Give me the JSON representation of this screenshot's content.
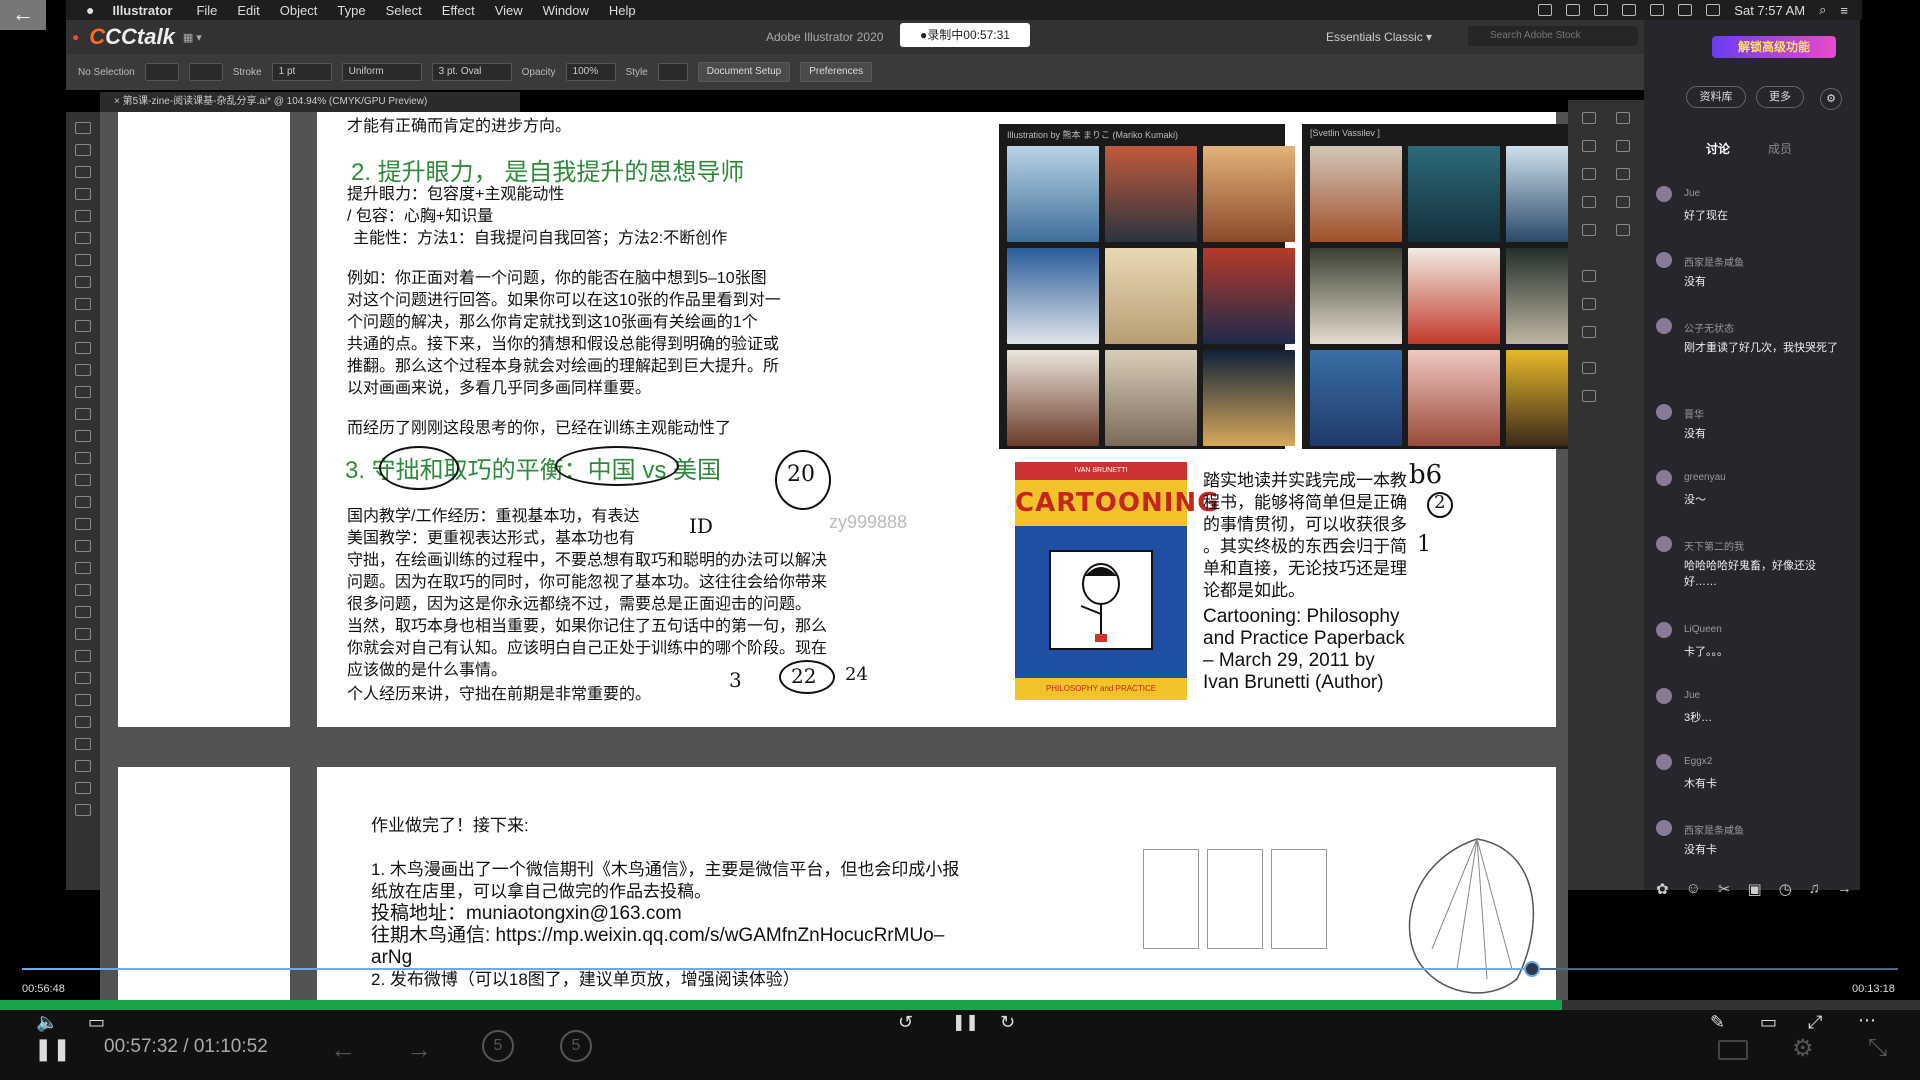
{
  "menubar": {
    "apple": "",
    "app": "Illustrator",
    "items": [
      "File",
      "Edit",
      "Object",
      "Type",
      "Select",
      "Effect",
      "View",
      "Window",
      "Help"
    ],
    "clock": "Sat 7:57 AM"
  },
  "titlebar": {
    "cctalk": "CCtalk",
    "ai_title": "Adobe Illustrator 2020",
    "recording": "●录制中00:57:31",
    "workspace": "Essentials Classic",
    "stock_placeholder": "Search Adobe Stock"
  },
  "control": {
    "selection": "No Selection",
    "stroke_label": "Stroke",
    "stroke_value": "1 pt",
    "profile": "Uniform",
    "brush": "3 pt. Oval",
    "opacity_label": "Opacity",
    "opacity_value": "100%",
    "style_label": "Style",
    "doc_setup": "Document Setup",
    "preferences": "Preferences"
  },
  "doctab": "× 第5课-zine-阅读课基-杂乱分享.ai* @ 104.94% (CMYK/GPU Preview)",
  "page1": {
    "line0": "才能有正确而肯定的进步方向。",
    "h2": "2. 提升眼力， 是自我提升的思想导师",
    "p1": "提升眼力：包容度+主观能动性",
    "p2": "/ 包容：心胸+知识量",
    "p3": "主能性：方法1：自我提问自我回答；方法2:不断创作",
    "p4": "例如：你正面对着一个问题，你的能否在脑中想到5–10张图",
    "p5": "对这个问题进行回答。如果你可以在这10张的作品里看到对一",
    "p6": "个问题的解决，那么你肯定就找到这10张画有关绘画的1个",
    "p7": "共通的点。接下来，当你的猜想和假设总能得到明确的验证或",
    "p8": "推翻。那么这个过程本身就会对绘画的理解起到巨大提升。所",
    "p9": "以对画画来说，多看几乎同多画同样重要。",
    "p10": "而经历了刚刚这段思考的你，已经在训练主观能动性了",
    "h3": "3. 守拙和取巧的平衡：中国 vs 美国",
    "q1": "国内教学/工作经历：重视基本功，有表达",
    "q2": "美国教学：更重视表达形式，基本功也有",
    "q3": "守拙，在绘画训练的过程中，不要总想有取巧和聪明的办法可以解决",
    "q4": "问题。因为在取巧的同时，你可能忽视了基本功。这往往会给你带来",
    "q5": "很多问题，因为这是你永远都绕不过，需要总是正面迎击的问题。",
    "q6": "当然，取巧本身也相当重要，如果你记住了五句话中的第一句，那么",
    "q7": "你就会对自己有认知。应该明白自己正处于训练中的哪个阶段。现在",
    "q8": "应该做的是什么事情。",
    "q9": "个人经历来讲，守拙在前期是非常重要的。",
    "collage1_title": "Illustration by 熊本 まりこ (Mariko Kumaki)",
    "collage2_title": "[Svetlin Vassilev ]",
    "book_top": "IVAN BRUNETTI",
    "book_title": "CARTOONING",
    "book_bottom": "PHILOSOPHY and PRACTICE",
    "r1": "踏实地读并实践完成一本教",
    "r2": "程书，能够将简单但是正确",
    "r3": "的事情贯彻，可以收获很多",
    "r4": "。其实终极的东西会归于简",
    "r5": "单和直接，无论技巧还是理",
    "r6": "论都是如此。",
    "e1": "Cartooning: Philosophy",
    "e2": "and Practice Paperback",
    "e3": "– March 29, 2011 by",
    "e4": "Ivan Brunetti (Author)",
    "watermark": "zy999888",
    "hand": {
      "a": "20",
      "b": "ID",
      "c": "22",
      "d": "3",
      "e": "24",
      "f": "b6",
      "g": "2",
      "h": "1"
    }
  },
  "page2": {
    "t1": "作业做完了！接下来:",
    "t2": "1. 木鸟漫画出了一个微信期刊《木鸟通信》，主要是微信平台，但也会印成小报",
    "t3": "纸放在店里，可以拿自己做完的作品去投稿。",
    "t4": "投稿地址：muniaotongxin@163.com",
    "t5": "往期木鸟通信: https://mp.weixin.qq.com/s/wGAMfnZnHocucRrMUo–",
    "t6": "arNg",
    "t7": "2. 发布微博（可以18图了，建议单页放，增强阅读体验）"
  },
  "chat": {
    "badge": "解锁高级功能",
    "btn1": "资料库",
    "btn2": "更多",
    "tab1": "讨论",
    "tab2": "成员",
    "messages": [
      {
        "name": "Jue",
        "text": "好了现在"
      },
      {
        "name": "西家是条咸鱼",
        "text": "没有"
      },
      {
        "name": "公子无状态",
        "text": "刚才重读了好几次，我快哭死了"
      },
      {
        "name": "晋华",
        "text": "没有"
      },
      {
        "name": "greenyau",
        "text": "没～"
      },
      {
        "name": "天下第二的我",
        "text": "哈哈哈哈好鬼畜，好像还没好……"
      },
      {
        "name": "LiQueen",
        "text": "卡了。。。"
      },
      {
        "name": "Jue",
        "text": "3秒…"
      },
      {
        "name": "Eggx2",
        "text": "木有卡"
      },
      {
        "name": "西家是条咸鱼",
        "text": "没有卡"
      }
    ]
  },
  "player": {
    "elapsed": "00:56:48",
    "remaining": "00:13:18",
    "current": "00:57:32",
    "sep": "/",
    "total": "01:10:52",
    "progress": 0.805
  },
  "colors": {
    "green_heading": "#2f8a3b",
    "accent_blue": "#6fa9e6",
    "progress_green": "#19a34a"
  }
}
